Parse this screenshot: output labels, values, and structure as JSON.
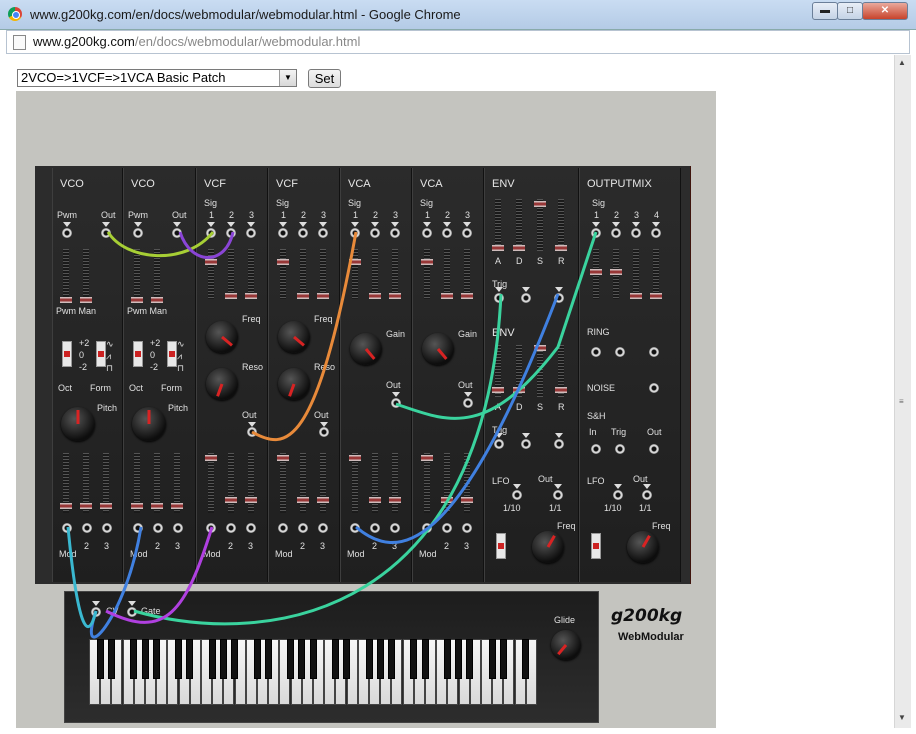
{
  "window": {
    "title": "www.g200kg.com/en/docs/webmodular/webmodular.html - Google Chrome",
    "min_glyph": "▬",
    "max_glyph": "□",
    "close_glyph": "✕"
  },
  "address": {
    "host": "www.g200kg.com",
    "path": "/en/docs/webmodular/webmodular.html"
  },
  "controls": {
    "patch_select_value": "2VCO=>1VCF=>1VCA Basic Patch",
    "set_label": "Set"
  },
  "synth": {
    "logo": "g200kg",
    "sublogo": "WebModular",
    "modules": [
      "VCO",
      "VCO",
      "VCF",
      "VCF",
      "VCA",
      "VCA",
      "ENV",
      "OUTPUTMIX"
    ],
    "vco": {
      "pwm": "Pwm",
      "out": "Out",
      "pwm_man": "Pwm Man",
      "oct": "Oct",
      "form": "Form",
      "pitch": "Pitch",
      "oct_values": [
        "+2",
        "0",
        "-2"
      ],
      "mod": "Mod",
      "nums": [
        "1",
        "2",
        "3"
      ]
    },
    "vcf": {
      "sig": "Sig",
      "freq": "Freq",
      "reso": "Reso",
      "out": "Out",
      "mod": "Mod",
      "nums": [
        "1",
        "2",
        "3"
      ]
    },
    "vca": {
      "sig": "Sig",
      "gain": "Gain",
      "out": "Out",
      "mod": "Mod",
      "nums": [
        "1",
        "2",
        "3"
      ]
    },
    "env": {
      "title": "ENV",
      "adsr": [
        "A",
        "D",
        "S",
        "R"
      ],
      "trig": "Trig"
    },
    "lfo": {
      "title": "LFO",
      "out": "Out",
      "rates": [
        "1/10",
        "1/1"
      ],
      "freq": "Freq"
    },
    "outmix": {
      "title": "OUTPUTMIX",
      "sig": "Sig",
      "nums": [
        "1",
        "2",
        "3",
        "4"
      ],
      "ring": "RING",
      "noise": "NOISE",
      "sh": "S&H",
      "sh_in": "In",
      "sh_trig": "Trig",
      "sh_out": "Out",
      "lfo": "LFO",
      "lfo_out": "Out",
      "lfo_rates": [
        "1/10",
        "1/1"
      ],
      "freq": "Freq"
    },
    "keyboard": {
      "cv": "CV",
      "gate": "Gate",
      "glide": "Glide"
    }
  }
}
